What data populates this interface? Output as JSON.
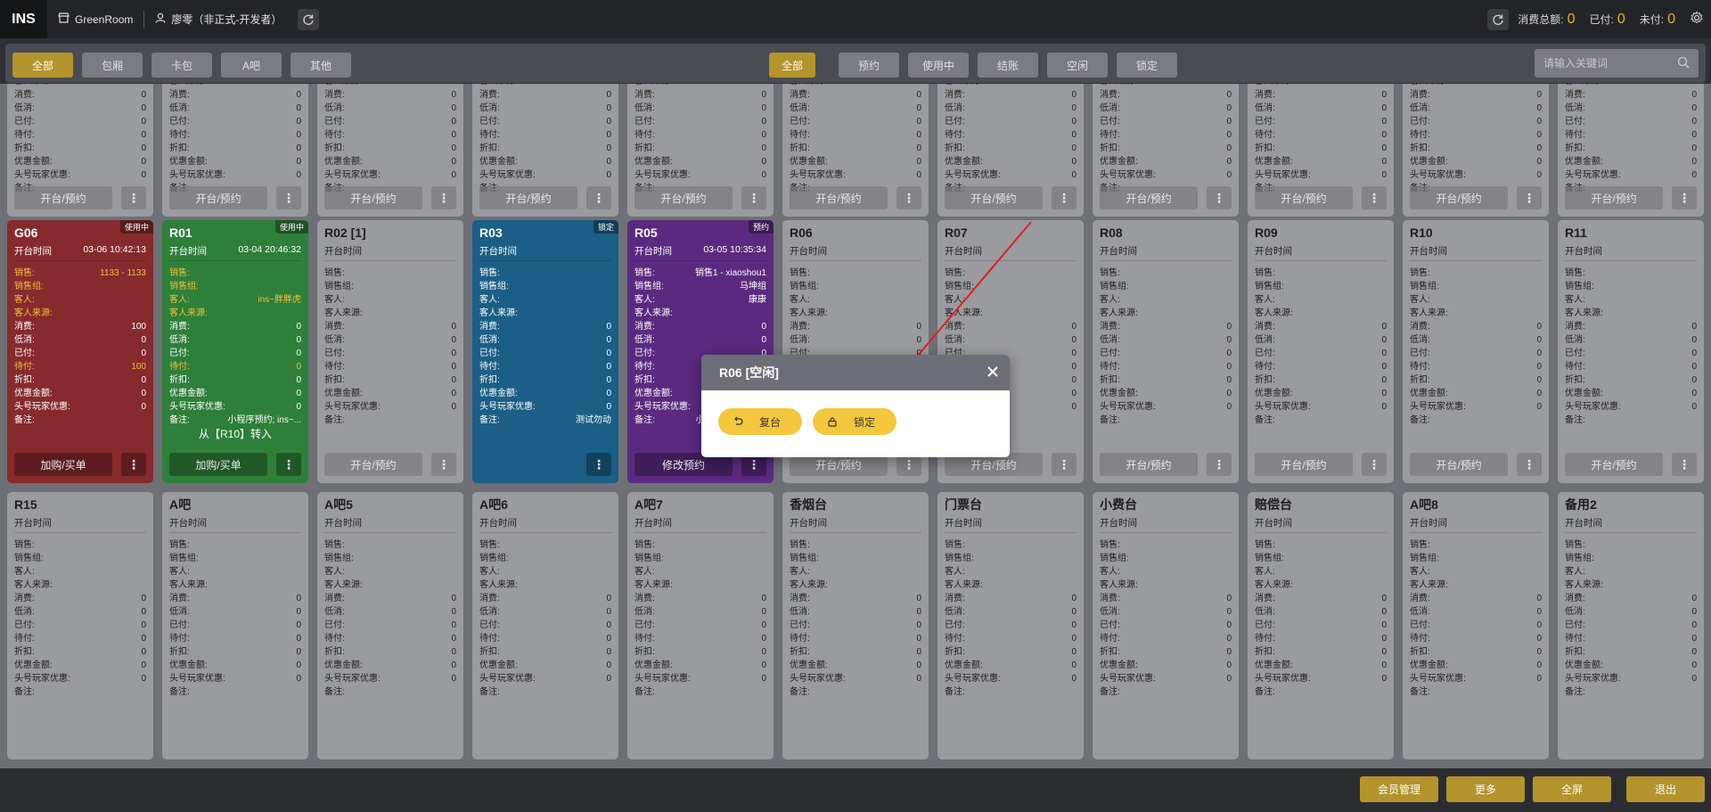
{
  "topbar": {
    "logo": "INS",
    "store": "GreenRoom",
    "user": "廖零（非正式-开发者）",
    "stats": [
      {
        "label": "消费总额:",
        "value": "0"
      },
      {
        "label": "已付:",
        "value": "0"
      },
      {
        "label": "未付:",
        "value": "0"
      }
    ]
  },
  "filters": {
    "area": [
      "全部",
      "包厢",
      "卡包",
      "A吧",
      "其他"
    ],
    "status": [
      "全部",
      "预约",
      "使用中",
      "结账",
      "空闲",
      "锁定"
    ],
    "search_placeholder": "请输入关键词"
  },
  "labels": {
    "open_time": "开台时间",
    "sales": "销售:",
    "sales_group": "销售组:",
    "guest": "客人:",
    "guest_source": "客人来源:",
    "consume": "消费:",
    "min_consume": "低消:",
    "paid": "已付:",
    "unpaid": "待付:",
    "discount": "折扣:",
    "coupon": "优惠金额:",
    "vip_discount": "头号玩家优惠:",
    "remark": "备注:",
    "open_btn": "开台/预约",
    "more_glyph": "⋮"
  },
  "row1": {
    "count": 11,
    "consume": "0",
    "min_consume": "0",
    "paid": "0",
    "unpaid": "0",
    "discount": "0",
    "coupon": "0",
    "vip_discount": "0",
    "action": "开台/预约"
  },
  "row2": [
    {
      "name": "G06",
      "badge": "使用中",
      "time": "03-06 10:42:13",
      "color": "#862a2e",
      "sales": "1133 - 1133",
      "sales_group": "",
      "guest": "",
      "guest_source": "",
      "consume": "100",
      "min_consume": "0",
      "paid": "0",
      "unpaid": "100",
      "discount": "0",
      "coupon": "0",
      "vip_discount": "0",
      "remark": "",
      "transfer": "",
      "action": "加购/买单",
      "accent": "#f0c03a"
    },
    {
      "name": "R01",
      "badge": "使用中",
      "time": "03-04 20:46:32",
      "color": "#2e7f3a",
      "sales": "",
      "sales_group": "",
      "guest": "ins~胖胖虎",
      "guest_source": "",
      "consume": "0",
      "min_consume": "0",
      "paid": "0",
      "unpaid": "0",
      "discount": "0",
      "coupon": "0",
      "vip_discount": "0",
      "remark": "小程序预约; ins~...",
      "transfer": "从【R10】转入",
      "action": "加购/买单",
      "accent": "#f0c03a"
    },
    {
      "name": "R02 [1]",
      "badge": "",
      "time": "",
      "color": "",
      "sales": "",
      "sales_group": "",
      "guest": "",
      "guest_source": "",
      "consume": "0",
      "min_consume": "0",
      "paid": "0",
      "unpaid": "0",
      "discount": "0",
      "coupon": "0",
      "vip_discount": "0",
      "remark": "",
      "transfer": "",
      "action": "开台/预约",
      "accent": ""
    },
    {
      "name": "R03",
      "badge": "锁定",
      "time": "",
      "color": "#1b5e86",
      "sales": "",
      "sales_group": "",
      "guest": "",
      "guest_source": "",
      "consume": "0",
      "min_consume": "0",
      "paid": "0",
      "unpaid": "0",
      "discount": "0",
      "coupon": "0",
      "vip_discount": "0",
      "remark": "测试勿动",
      "transfer": "",
      "action": "",
      "accent": ""
    },
    {
      "name": "R05",
      "badge": "预约",
      "time": "03-05 10:35:34",
      "color": "#5b2a80",
      "sales": "销售1 - xiaoshou1",
      "sales_group": "马坤组",
      "guest": "康康",
      "guest_source": "",
      "consume": "0",
      "min_consume": "0",
      "paid": "0",
      "unpaid": "0",
      "discount": "0",
      "coupon": "0",
      "vip_discount": "0",
      "remark": "小程序预约; GO...",
      "transfer": "",
      "action": "修改预约",
      "accent": ""
    },
    {
      "name": "R06",
      "badge": "",
      "time": "",
      "color": "",
      "sales": "",
      "sales_group": "",
      "guest": "",
      "guest_source": "",
      "consume": "0",
      "min_consume": "0",
      "paid": "0",
      "unpaid": "0",
      "discount": "0",
      "coupon": "0",
      "vip_discount": "0",
      "remark": "",
      "transfer": "",
      "action": "开台/预约",
      "accent": ""
    },
    {
      "name": "R07",
      "badge": "",
      "time": "",
      "color": "",
      "sales": "",
      "sales_group": "",
      "guest": "",
      "guest_source": "",
      "consume": "0",
      "min_consume": "0",
      "paid": "0",
      "unpaid": "0",
      "discount": "0",
      "coupon": "0",
      "vip_discount": "0",
      "remark": "",
      "transfer": "",
      "action": "开台/预约",
      "accent": ""
    },
    {
      "name": "R08",
      "badge": "",
      "time": "",
      "color": "",
      "sales": "",
      "sales_group": "",
      "guest": "",
      "guest_source": "",
      "consume": "0",
      "min_consume": "0",
      "paid": "0",
      "unpaid": "0",
      "discount": "0",
      "coupon": "0",
      "vip_discount": "0",
      "remark": "",
      "transfer": "",
      "action": "开台/预约",
      "accent": ""
    },
    {
      "name": "R09",
      "badge": "",
      "time": "",
      "color": "",
      "sales": "",
      "sales_group": "",
      "guest": "",
      "guest_source": "",
      "consume": "0",
      "min_consume": "0",
      "paid": "0",
      "unpaid": "0",
      "discount": "0",
      "coupon": "0",
      "vip_discount": "0",
      "remark": "",
      "transfer": "",
      "action": "开台/预约",
      "accent": ""
    },
    {
      "name": "R10",
      "badge": "",
      "time": "",
      "color": "",
      "sales": "",
      "sales_group": "",
      "guest": "",
      "guest_source": "",
      "consume": "0",
      "min_consume": "0",
      "paid": "0",
      "unpaid": "0",
      "discount": "0",
      "coupon": "0",
      "vip_discount": "0",
      "remark": "",
      "transfer": "",
      "action": "开台/预约",
      "accent": ""
    },
    {
      "name": "R11",
      "badge": "",
      "time": "",
      "color": "",
      "sales": "",
      "sales_group": "",
      "guest": "",
      "guest_source": "",
      "consume": "0",
      "min_consume": "0",
      "paid": "0",
      "unpaid": "0",
      "discount": "0",
      "coupon": "0",
      "vip_discount": "0",
      "remark": "",
      "transfer": "",
      "action": "开台/预约",
      "accent": ""
    }
  ],
  "row3": [
    "R15",
    "A吧",
    "A吧5",
    "A吧6",
    "A吧7",
    "香烟台",
    "门票台",
    "小费台",
    "赔偿台",
    "A吧8",
    "备用2"
  ],
  "modal": {
    "title": "R06 [空闲]",
    "restore_label": "复台",
    "lock_label": "锁定"
  },
  "bottom": {
    "member": "会员管理",
    "more": "更多",
    "fullscreen": "全屏",
    "logout": "退出"
  },
  "colors": {
    "accent": "#b4942c",
    "arrow": "#e02020",
    "button_yellow": "#f4c73f"
  }
}
